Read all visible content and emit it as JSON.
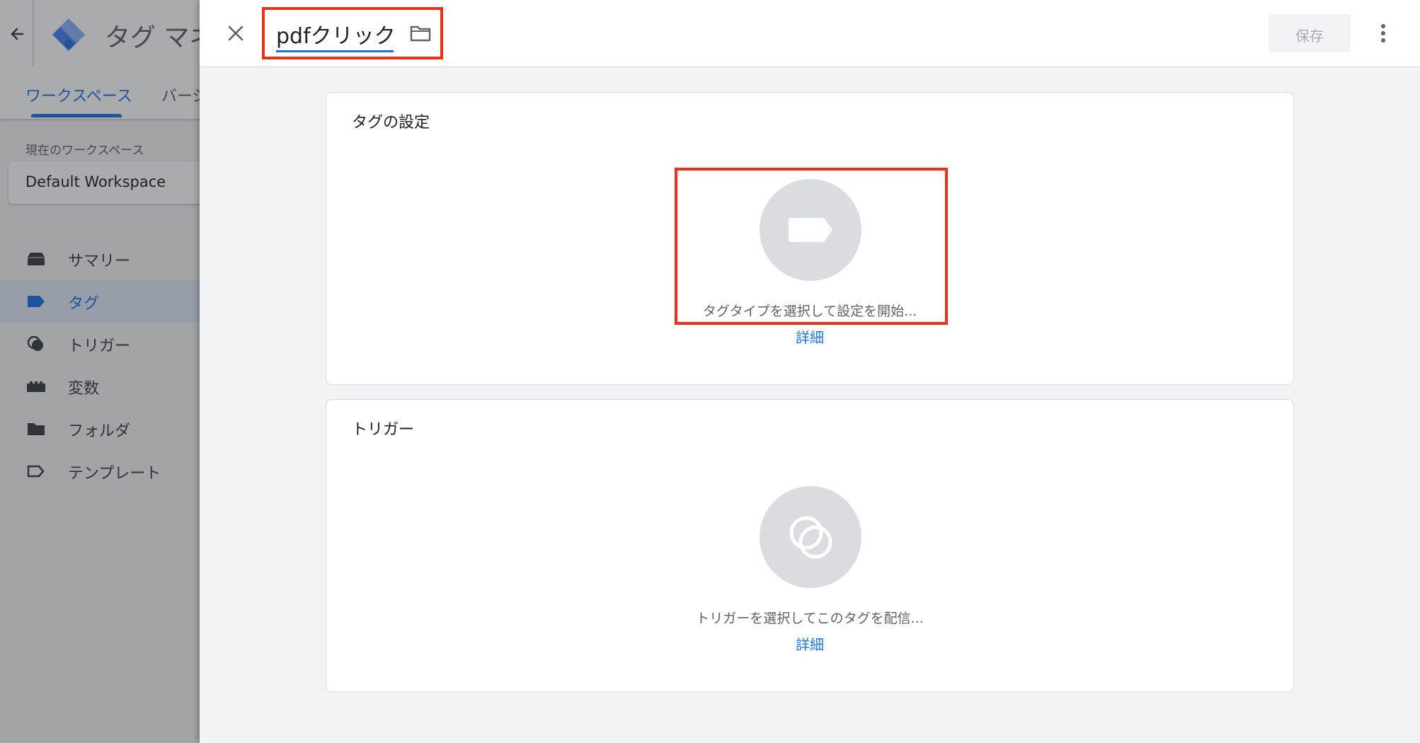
{
  "app": {
    "title": "タグ マネ",
    "tabs": [
      "ワークスペース",
      "バージ"
    ],
    "workspace_label": "現在のワークスペース",
    "workspace_name": "Default Workspace",
    "nav": [
      {
        "label": "サマリー",
        "icon": "inbox-icon"
      },
      {
        "label": "タグ",
        "icon": "tag-icon",
        "active": true
      },
      {
        "label": "トリガー",
        "icon": "trigger-icon"
      },
      {
        "label": "変数",
        "icon": "variables-icon"
      },
      {
        "label": "フォルダ",
        "icon": "folder-icon"
      },
      {
        "label": "テンプレート",
        "icon": "template-icon"
      }
    ]
  },
  "panel": {
    "tag_name": "pdfクリック",
    "save_label": "保存",
    "tag_config": {
      "title": "タグの設定",
      "hint": "タグタイプを選択して設定を開始...",
      "link": "詳細"
    },
    "triggering": {
      "title": "トリガー",
      "hint": "トリガーを選択してこのタグを配信...",
      "link": "詳細"
    }
  },
  "colors": {
    "accent": "#1a73e8",
    "highlight": "#e8321a",
    "placeholder": "#dadce0"
  }
}
